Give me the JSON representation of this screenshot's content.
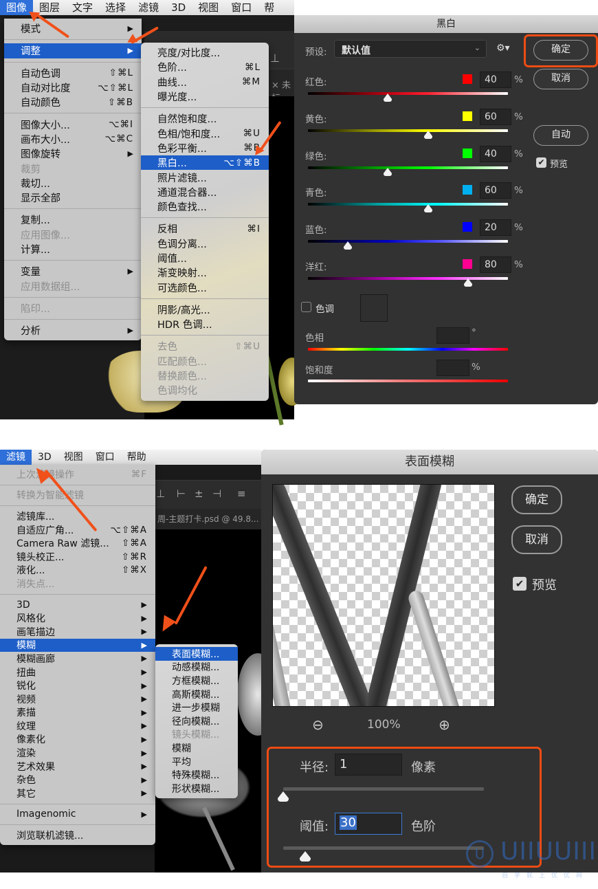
{
  "top": {
    "menubar": [
      "图像",
      "图层",
      "文字",
      "选择",
      "滤镜",
      "3D",
      "视图",
      "窗口",
      "帮"
    ],
    "active_menu_index": 0,
    "image_menu": [
      {
        "label": "模式",
        "shortcut": "",
        "submenu": true
      },
      {
        "sep": true
      },
      {
        "label": "调整",
        "shortcut": "",
        "submenu": true,
        "highlighted": true
      },
      {
        "sep": true
      },
      {
        "label": "自动色调",
        "shortcut": "⇧⌘L"
      },
      {
        "label": "自动对比度",
        "shortcut": "⌥⇧⌘L"
      },
      {
        "label": "自动颜色",
        "shortcut": "⇧⌘B"
      },
      {
        "sep": true
      },
      {
        "label": "图像大小...",
        "shortcut": "⌥⌘I"
      },
      {
        "label": "画布大小...",
        "shortcut": "⌥⌘C"
      },
      {
        "label": "图像旋转",
        "shortcut": "",
        "submenu": true
      },
      {
        "label": "裁剪",
        "shortcut": "",
        "disabled": true
      },
      {
        "label": "裁切...",
        "shortcut": ""
      },
      {
        "label": "显示全部",
        "shortcut": ""
      },
      {
        "sep": true
      },
      {
        "label": "复制...",
        "shortcut": ""
      },
      {
        "label": "应用图像...",
        "shortcut": "",
        "disabled": true
      },
      {
        "label": "计算...",
        "shortcut": ""
      },
      {
        "sep": true
      },
      {
        "label": "变量",
        "shortcut": "",
        "submenu": true
      },
      {
        "label": "应用数据组...",
        "shortcut": "",
        "disabled": true
      },
      {
        "sep": true
      },
      {
        "label": "陷印...",
        "shortcut": "",
        "disabled": true
      },
      {
        "sep": true
      },
      {
        "label": "分析",
        "shortcut": "",
        "submenu": true
      }
    ],
    "adjust_submenu": [
      {
        "label": "亮度/对比度...",
        "shortcut": ""
      },
      {
        "label": "色阶...",
        "shortcut": "⌘L"
      },
      {
        "label": "曲线...",
        "shortcut": "⌘M"
      },
      {
        "label": "曝光度...",
        "shortcut": ""
      },
      {
        "sep": true
      },
      {
        "label": "自然饱和度...",
        "shortcut": ""
      },
      {
        "label": "色相/饱和度...",
        "shortcut": "⌘U"
      },
      {
        "label": "色彩平衡...",
        "shortcut": "⌘B"
      },
      {
        "label": "黑白...",
        "shortcut": "⌥⇧⌘B",
        "highlighted": true
      },
      {
        "label": "照片滤镜...",
        "shortcut": ""
      },
      {
        "label": "通道混合器...",
        "shortcut": ""
      },
      {
        "label": "颜色查找...",
        "shortcut": ""
      },
      {
        "sep": true
      },
      {
        "label": "反相",
        "shortcut": "⌘I"
      },
      {
        "label": "色调分离...",
        "shortcut": ""
      },
      {
        "label": "阈值...",
        "shortcut": ""
      },
      {
        "label": "渐变映射...",
        "shortcut": ""
      },
      {
        "label": "可选颜色...",
        "shortcut": ""
      },
      {
        "sep": true
      },
      {
        "label": "阴影/高光...",
        "shortcut": ""
      },
      {
        "label": "HDR 色调...",
        "shortcut": ""
      },
      {
        "sep": true
      },
      {
        "label": "去色",
        "shortcut": "⇧⌘U",
        "disabled": true
      },
      {
        "label": "匹配颜色...",
        "shortcut": "",
        "disabled": true
      },
      {
        "label": "替换颜色...",
        "shortcut": "",
        "disabled": true
      },
      {
        "label": "色调均化",
        "shortcut": "",
        "disabled": true
      }
    ],
    "tab_text": "× 未标",
    "bw_dialog": {
      "title": "黑白",
      "preset_label": "预设:",
      "preset_value": "默认值",
      "ok": "确定",
      "cancel": "取消",
      "auto": "自动",
      "preview": "预览",
      "preview_checked": true,
      "percent": "%",
      "channels": [
        {
          "label": "红色:",
          "value": "40",
          "fraction": 0.4,
          "color": "#ff0000",
          "grad": "linear-gradient(90deg,#000,#c00010 40%,#ff2030 60%,#fff)"
        },
        {
          "label": "黄色:",
          "value": "60",
          "fraction": 0.6,
          "color": "#ffff00",
          "grad": "linear-gradient(90deg,#000,#a0a000 35%,#ffff00 60%,#fff)"
        },
        {
          "label": "绿色:",
          "value": "40",
          "fraction": 0.4,
          "color": "#00ff00",
          "grad": "linear-gradient(90deg,#000,#00a000 35%,#00ff00 60%,#fff)"
        },
        {
          "label": "青色:",
          "value": "60",
          "fraction": 0.6,
          "color": "#00b0f0",
          "grad": "linear-gradient(90deg,#000,#00a0a0 35%,#00ffff 65%,#fff)"
        },
        {
          "label": "蓝色:",
          "value": "20",
          "fraction": 0.2,
          "color": "#0000ff",
          "grad": "linear-gradient(90deg,#000,#0000c0 40%,#5050ff 65%,#fff)"
        },
        {
          "label": "洋红:",
          "value": "80",
          "fraction": 0.8,
          "color": "#ff0090",
          "grad": "linear-gradient(90deg,#000,#a000a0 35%,#ff30ff 65%,#fff)"
        }
      ],
      "tint_label": "色调",
      "tint_checked": false,
      "hue_label": "色相",
      "hue_unit": "°",
      "hue_value": "",
      "saturation_label": "饱和度",
      "saturation_unit": "%",
      "saturation_value": ""
    }
  },
  "bottom": {
    "menubar": [
      "滤镜",
      "3D",
      "视图",
      "窗口",
      "帮助"
    ],
    "active_menu_index": 0,
    "filter_menu": [
      {
        "label": "上次滤镜操作",
        "shortcut": "⌘F",
        "disabled": true
      },
      {
        "sep": true
      },
      {
        "label": "转换为智能滤镜",
        "shortcut": "",
        "disabled": true
      },
      {
        "sep": true
      },
      {
        "label": "滤镜库...",
        "shortcut": ""
      },
      {
        "label": "自适应广角...",
        "shortcut": "⌥⇧⌘A"
      },
      {
        "label": "Camera Raw 滤镜...",
        "shortcut": "⇧⌘A"
      },
      {
        "label": "镜头校正...",
        "shortcut": "⇧⌘R"
      },
      {
        "label": "液化...",
        "shortcut": "⇧⌘X"
      },
      {
        "label": "消失点...",
        "shortcut": "",
        "disabled": true
      },
      {
        "sep": true
      },
      {
        "label": "3D",
        "shortcut": "",
        "submenu": true
      },
      {
        "label": "风格化",
        "shortcut": "",
        "submenu": true
      },
      {
        "label": "画笔描边",
        "shortcut": "",
        "submenu": true
      },
      {
        "label": "模糊",
        "shortcut": "",
        "submenu": true,
        "highlighted": true
      },
      {
        "label": "模糊画廊",
        "shortcut": "",
        "submenu": true
      },
      {
        "label": "扭曲",
        "shortcut": "",
        "submenu": true
      },
      {
        "label": "锐化",
        "shortcut": "",
        "submenu": true
      },
      {
        "label": "视频",
        "shortcut": "",
        "submenu": true
      },
      {
        "label": "素描",
        "shortcut": "",
        "submenu": true
      },
      {
        "label": "纹理",
        "shortcut": "",
        "submenu": true
      },
      {
        "label": "像素化",
        "shortcut": "",
        "submenu": true
      },
      {
        "label": "渲染",
        "shortcut": "",
        "submenu": true
      },
      {
        "label": "艺术效果",
        "shortcut": "",
        "submenu": true
      },
      {
        "label": "杂色",
        "shortcut": "",
        "submenu": true
      },
      {
        "label": "其它",
        "shortcut": "",
        "submenu": true
      },
      {
        "sep": true
      },
      {
        "label": "Imagenomic",
        "shortcut": "",
        "submenu": true
      },
      {
        "sep": true
      },
      {
        "label": "浏览联机滤镜...",
        "shortcut": ""
      }
    ],
    "blur_submenu": [
      {
        "label": "表面模糊...",
        "highlighted": true
      },
      {
        "label": "动感模糊..."
      },
      {
        "label": "方框模糊..."
      },
      {
        "label": "高斯模糊..."
      },
      {
        "label": "进一步模糊"
      },
      {
        "label": "径向模糊..."
      },
      {
        "label": "镜头模糊...",
        "disabled": true
      },
      {
        "label": "模糊"
      },
      {
        "label": "平均"
      },
      {
        "label": "特殊模糊..."
      },
      {
        "label": "形状模糊..."
      }
    ],
    "tab_text": "周-主题打卡.psd @ 49.8...",
    "blur_dialog": {
      "title": "表面模糊",
      "ok": "确定",
      "cancel": "取消",
      "preview": "预览",
      "preview_checked": true,
      "zoom": "100%",
      "radius_label": "半径:",
      "radius_value": "1",
      "radius_unit": "像素",
      "radius_fraction": 0.0,
      "threshold_label": "阈值:",
      "threshold_value": "30",
      "threshold_unit": "色阶",
      "threshold_fraction": 0.11
    }
  },
  "watermark": {
    "logo": "UIIUUIII",
    "tagline": "自学就上优优网"
  }
}
